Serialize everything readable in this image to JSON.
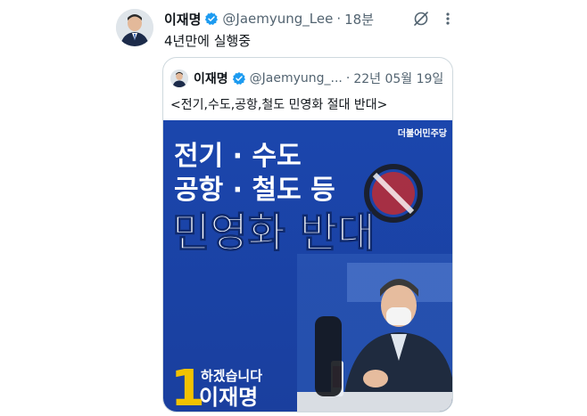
{
  "tweet": {
    "author_name": "이재명",
    "handle": "@Jaemyung_Lee",
    "separator": "·",
    "time": "18분",
    "text": "4년만에 실행중"
  },
  "quote": {
    "author_name": "이재명",
    "handle": "@Jaemyung_...",
    "separator": "·",
    "time": "22년 05월 19일",
    "text": "<전기,수도,공항,철도 민영화 절대 반대>",
    "image": {
      "party_logo": "더불어민주당",
      "headline_line1": "전기 · 수도",
      "headline_line2": "공항 · 철도 등",
      "headline_big": "민영화 반대",
      "badge_number": "1",
      "badge_slogan": "하겠습니다",
      "badge_name": "이재명",
      "background_color": "#1f45a8"
    }
  },
  "icons": {
    "verified": "verified-badge-icon",
    "grok": "grok-icon",
    "more": "more-options-icon"
  },
  "colors": {
    "text_primary": "#0f1419",
    "text_secondary": "#536471",
    "verified_blue": "#1d9bf0",
    "border": "#cfd9de"
  }
}
